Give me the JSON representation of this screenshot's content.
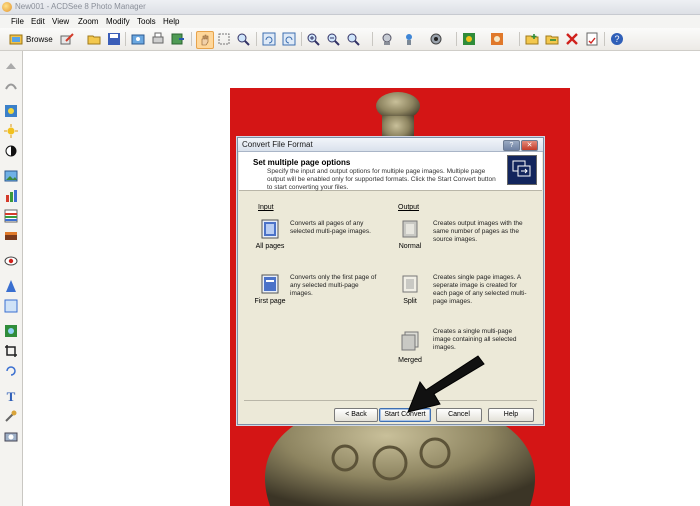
{
  "app": {
    "title": "New001 - ACDSee 8 Photo Manager"
  },
  "menu": [
    "File",
    "Edit",
    "View",
    "Zoom",
    "Modify",
    "Tools",
    "Help"
  ],
  "toolbar": {
    "browse_label": "Browse"
  },
  "dialog": {
    "title": "Convert File Format",
    "help_glyph": "?",
    "close_glyph": "✕",
    "header": {
      "heading": "Set multiple page options",
      "description": "Specify the input and output options for multiple page images. Multiple page output will be enabled only for supported formats. Click the Start Convert button to start converting your files."
    },
    "input": {
      "label": "Input",
      "options": [
        {
          "label": "All pages",
          "description": "Converts all pages of any selected multi-page images."
        },
        {
          "label": "First page",
          "description": "Converts only the first page of any selected multi-page images."
        }
      ]
    },
    "output": {
      "label": "Output",
      "options": [
        {
          "label": "Normal",
          "description": "Creates output images with the same number of pages as the source images."
        },
        {
          "label": "Split",
          "description": "Creates single page images. A seperate image is created for each page of any selected multi-page images."
        },
        {
          "label": "Merged",
          "description": "Creates a single multi-page image containing all selected images."
        }
      ]
    },
    "buttons": {
      "back": "< Back",
      "start": "Start Convert",
      "cancel": "Cancel",
      "help": "Help"
    }
  },
  "colors": {
    "photo_background": "#d41515",
    "arrow": "#111111",
    "dialog_face": "#ece9d8"
  },
  "icons": {
    "toolbar": [
      "browse-icon",
      "edit-icon",
      "folder-open-icon",
      "save-icon",
      "acquire-icon",
      "print-icon",
      "export-icon",
      "hand-icon",
      "zoom-icon",
      "rotate-left-icon",
      "rotate-right-icon",
      "zoom-in-icon",
      "zoom-out-icon",
      "zoom-fit-icon",
      "slideshow-icon",
      "tools-icon",
      "view-icon",
      "green-image-icon",
      "orange-image-icon",
      "add-icon",
      "move-icon",
      "delete-icon",
      "properties-icon",
      "help-icon"
    ],
    "sidebar": [
      "arrow-icon",
      "arrow2-icon",
      "exposure-icon",
      "sun-icon",
      "contrast-icon",
      "picture-icon",
      "levels-icon",
      "curves-icon",
      "color-icon",
      "red-eye-icon",
      "sharpen-icon",
      "frame-icon",
      "effects-icon",
      "crop-icon",
      "rotate-icon",
      "text-icon",
      "tool-icon",
      "camera-icon"
    ]
  }
}
